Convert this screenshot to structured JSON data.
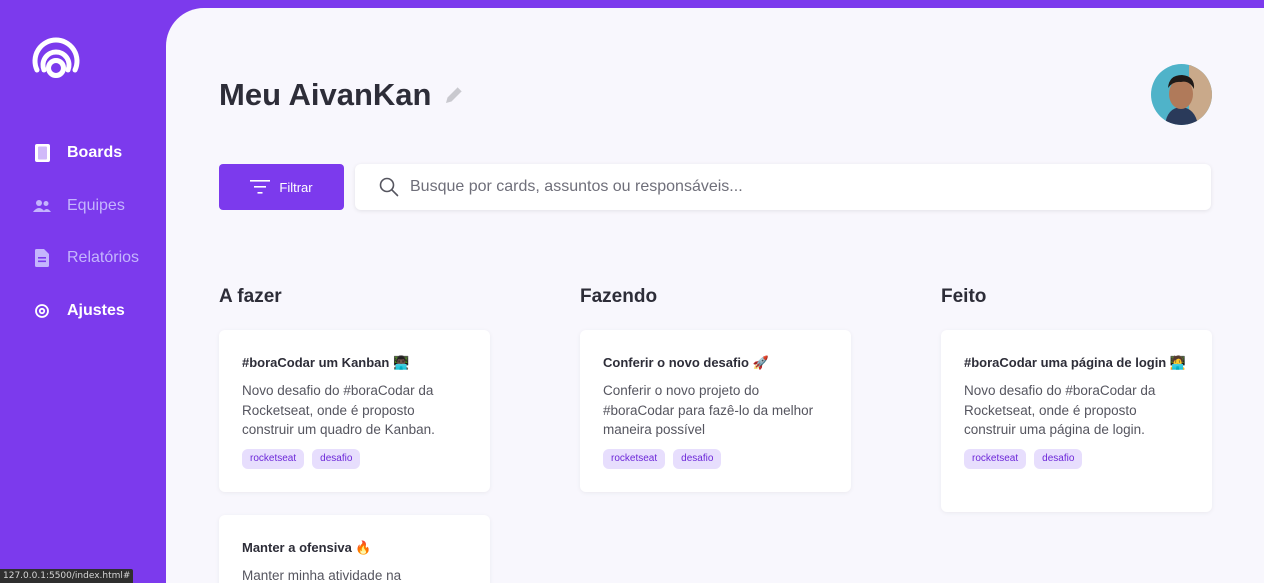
{
  "sidebar": {
    "logo": "wave-logo",
    "items": [
      {
        "label": "Boards",
        "icon": "board-icon",
        "active": true
      },
      {
        "label": "Equipes",
        "icon": "team-icon",
        "active": false
      },
      {
        "label": "Relatórios",
        "icon": "file-icon",
        "active": false
      },
      {
        "label": "Ajustes",
        "icon": "gear-icon",
        "active": true
      }
    ]
  },
  "status_url": "127.0.0.1:5500/index.html#",
  "header": {
    "title": "Meu AivanKan",
    "edit_icon": "pencil-icon",
    "avatar": "user-avatar"
  },
  "toolbar": {
    "filter_label": "Filtrar",
    "search_placeholder": "Busque por cards, assuntos ou responsáveis..."
  },
  "columns": [
    {
      "title": "A fazer",
      "cards": [
        {
          "title": "#boraCodar um Kanban 👨🏿‍💻",
          "description": "Novo desafio do #boraCodar da Rocketseat, onde é proposto construir um quadro de Kanban.",
          "tags": [
            "rocketseat",
            "desafio"
          ]
        },
        {
          "title": "Manter a ofensiva 🔥",
          "description": "Manter minha atividade na",
          "tags": []
        }
      ]
    },
    {
      "title": "Fazendo",
      "cards": [
        {
          "title": "Conferir o novo desafio 🚀",
          "description": "Conferir o novo projeto do #boraCodar para fazê-lo da melhor maneira possível",
          "tags": [
            "rocketseat",
            "desafio"
          ]
        }
      ]
    },
    {
      "title": "Feito",
      "cards": [
        {
          "title": "#boraCodar uma página de login 🧑‍💻",
          "description": "Novo desafio do #boraCodar da Rocketseat, onde é proposto construir uma página de login.",
          "tags": [
            "rocketseat",
            "desafio"
          ]
        }
      ]
    }
  ],
  "colors": {
    "accent": "#7c3aed",
    "background": "#f8f7fd",
    "tag_bg": "#e7defd",
    "tag_text": "#6d28d9"
  }
}
